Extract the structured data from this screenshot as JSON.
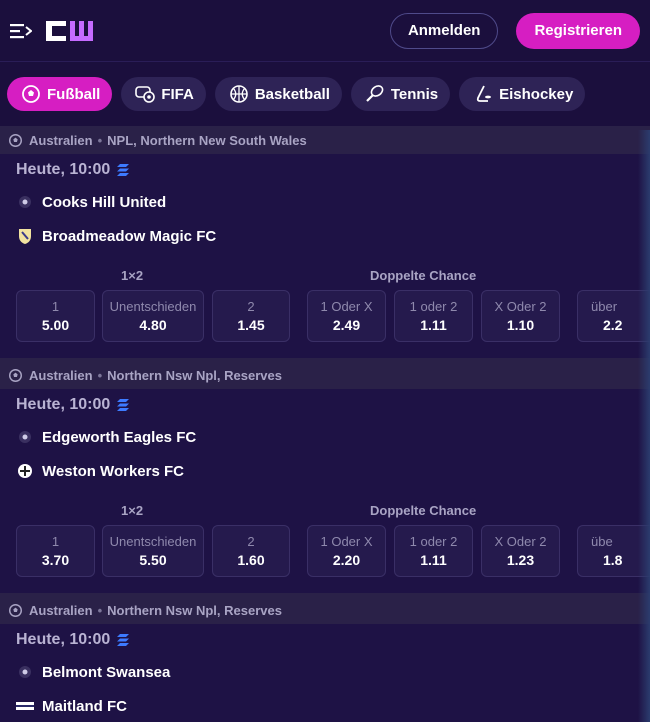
{
  "header": {
    "login_label": "Anmelden",
    "register_label": "Registrieren"
  },
  "sports": [
    {
      "label": "Fußball",
      "icon": "football-icon",
      "active": true
    },
    {
      "label": "FIFA",
      "icon": "gamepad-icon",
      "active": false
    },
    {
      "label": "Basketball",
      "icon": "basketball-icon",
      "active": false
    },
    {
      "label": "Tennis",
      "icon": "tennis-icon",
      "active": false
    },
    {
      "label": "Eishockey",
      "icon": "hockey-icon",
      "active": false
    }
  ],
  "events": [
    {
      "country": "Australien",
      "league": "NPL, Northern New South Wales",
      "time": "Heute, 10:00",
      "team1": "Cooks Hill United",
      "team2": "Broadmeadow Magic FC",
      "market1": "1×2",
      "market2": "Doppelte Chance",
      "odds": [
        {
          "label": "1",
          "value": "5.00"
        },
        {
          "label": "Unentschieden",
          "value": "4.80"
        },
        {
          "label": "2",
          "value": "1.45"
        },
        {
          "label": "1 Oder X",
          "value": "2.49"
        },
        {
          "label": "1 oder 2",
          "value": "1.11"
        },
        {
          "label": "X Oder 2",
          "value": "1.10"
        },
        {
          "label": "über",
          "value": "2.2"
        }
      ]
    },
    {
      "country": "Australien",
      "league": "Northern Nsw Npl, Reserves",
      "time": "Heute, 10:00",
      "team1": "Edgeworth Eagles FC",
      "team2": "Weston Workers FC",
      "market1": "1×2",
      "market2": "Doppelte Chance",
      "odds": [
        {
          "label": "1",
          "value": "3.70"
        },
        {
          "label": "Unentschieden",
          "value": "5.50"
        },
        {
          "label": "2",
          "value": "1.60"
        },
        {
          "label": "1 Oder X",
          "value": "2.20"
        },
        {
          "label": "1 oder 2",
          "value": "1.11"
        },
        {
          "label": "X Oder 2",
          "value": "1.23"
        },
        {
          "label": "übe",
          "value": "1.8"
        }
      ]
    },
    {
      "country": "Australien",
      "league": "Northern Nsw Npl, Reserves",
      "time": "Heute, 10:00",
      "team1": "Belmont Swansea",
      "team2": "Maitland FC"
    }
  ],
  "colors": {
    "accent": "#d61ec2",
    "background": "#1a0f3a",
    "tile": "#251a4d",
    "live_icon": "#3d7bff"
  }
}
